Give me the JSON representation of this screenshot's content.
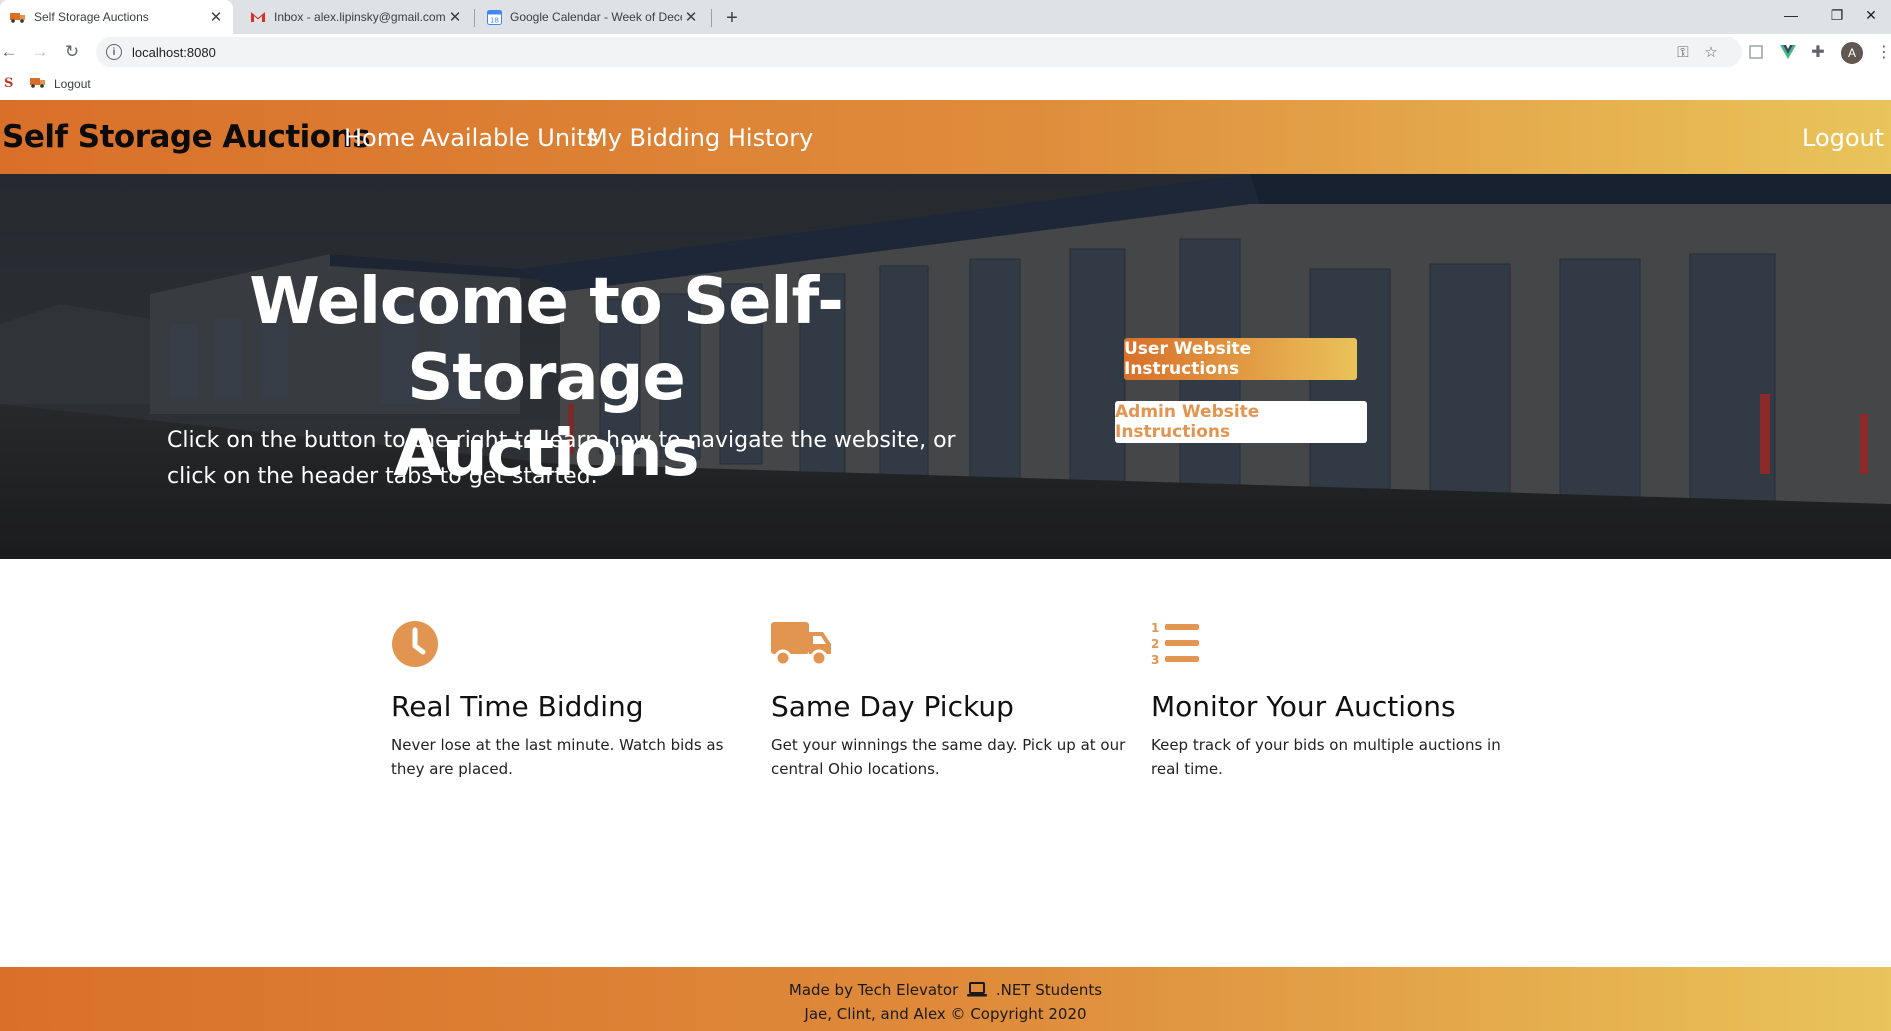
{
  "browser": {
    "tabs": [
      {
        "title": "Self Storage Auctions",
        "icon": "truck-favicon"
      },
      {
        "title": "Inbox - alex.lipinsky@gmail.com",
        "icon": "gmail-favicon"
      },
      {
        "title": "Google Calendar - Week of Dece",
        "icon": "calendar-favicon"
      }
    ],
    "url": "localhost:8080",
    "bookmarks": [
      {
        "label": "",
        "icon": "s-favicon"
      },
      {
        "label": "Logout",
        "icon": "truck-favicon"
      }
    ],
    "avatar_letter": "A"
  },
  "header": {
    "brand": "Self Storage Auctions",
    "nav": [
      "Home",
      "Available Units",
      "My Bidding History"
    ],
    "logout": "Logout"
  },
  "hero": {
    "title_line1": "Welcome to Self-Storage",
    "title_line2": "Auctions",
    "subtitle": "Click on the button to the right to learn how to navigate the website, or click on the header tabs to get started.",
    "user_button": "User Website Instructions",
    "admin_button": "Admin Website Instructions"
  },
  "features": [
    {
      "icon": "clock-icon",
      "title": "Real Time Bidding",
      "text": "Never lose at the last minute. Watch bids as they are placed."
    },
    {
      "icon": "truck-icon",
      "title": "Same Day Pickup",
      "text": "Get your winnings the same day. Pick up at our central Ohio locations."
    },
    {
      "icon": "numbered-list-icon",
      "title": "Monitor Your Auctions",
      "text": "Keep track of your bids on multiple auctions in real time."
    }
  ],
  "footer": {
    "line1_before": "Made by Tech Elevator",
    "line1_after": ".NET Students",
    "line2": "Jae, Clint, and Alex © Copyright 2020"
  },
  "colors": {
    "accent_start": "#d9702a",
    "accent_end": "#e9c45a",
    "icon_orange": "#e29550"
  }
}
